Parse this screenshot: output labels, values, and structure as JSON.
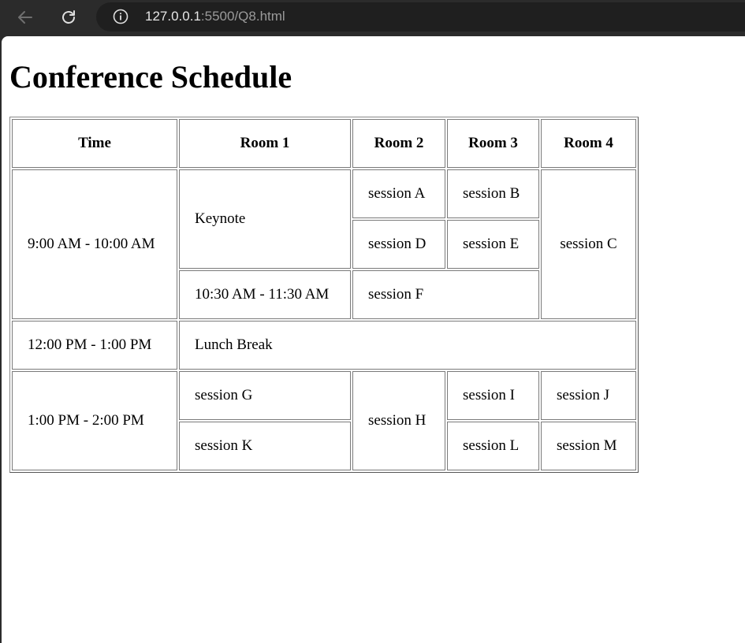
{
  "browser": {
    "url_host": "127.0.0.1",
    "url_path": ":5500/Q8.html"
  },
  "page": {
    "title": "Conference Schedule"
  },
  "table": {
    "headers": [
      "Time",
      "Room 1",
      "Room 2",
      "Room 3",
      "Room 4"
    ],
    "row1": {
      "time": "9:00 AM - 10:00 AM",
      "keynote": "Keynote",
      "session_a": "session A",
      "session_b": "session B",
      "session_c": "session C",
      "session_d": "session D",
      "session_e": "session E",
      "time_2": "10:30 AM - 11:30 AM",
      "session_f": "session F"
    },
    "row2": {
      "time": "12:00 PM - 1:00 PM",
      "lunch": "Lunch Break"
    },
    "row3": {
      "time": "1:00 PM - 2:00 PM",
      "session_g": "session G",
      "session_h": "session H",
      "session_i": "session I",
      "session_j": "session J",
      "session_k": "session K",
      "session_l": "session L",
      "session_m": "session M"
    }
  }
}
